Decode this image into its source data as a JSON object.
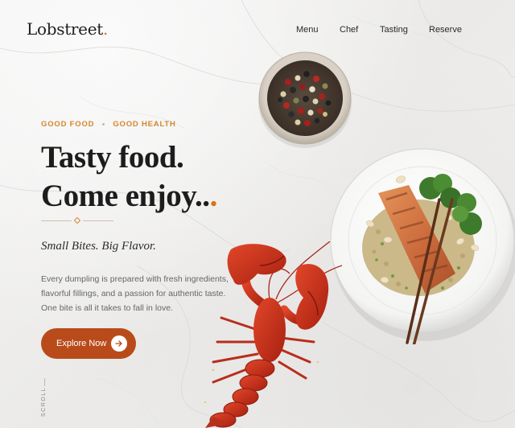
{
  "brand": {
    "name": "Lobstreet",
    "dot": ".",
    "accent": "#d4761d"
  },
  "nav": {
    "items": [
      "Menu",
      "Chef",
      "Tasting",
      "Reserve"
    ]
  },
  "hero": {
    "eyebrow_left": "GOOD FOOD",
    "eyebrow_right": "GOOD HEALTH",
    "headline_line1": "Tasty food.",
    "headline_line2": "Come enjoy..",
    "headline_dot": ".",
    "tagline": "Small Bites. Big Flavor.",
    "description_lines": [
      "Every dumpling is prepared with fresh ingredients,",
      "flavorful fillings, and a passion for authentic taste.",
      "One bite is all it takes to fall in love."
    ],
    "cta_label": "Explore Now",
    "cta_color": "#b94b1b",
    "scroll_label": "SCROLL"
  },
  "images": {
    "spice_bowl": "bowl-of-peppercorns",
    "plate": "salmon-quinoa-broccoli-plate-with-chopsticks",
    "lobster": "red-lobster"
  }
}
